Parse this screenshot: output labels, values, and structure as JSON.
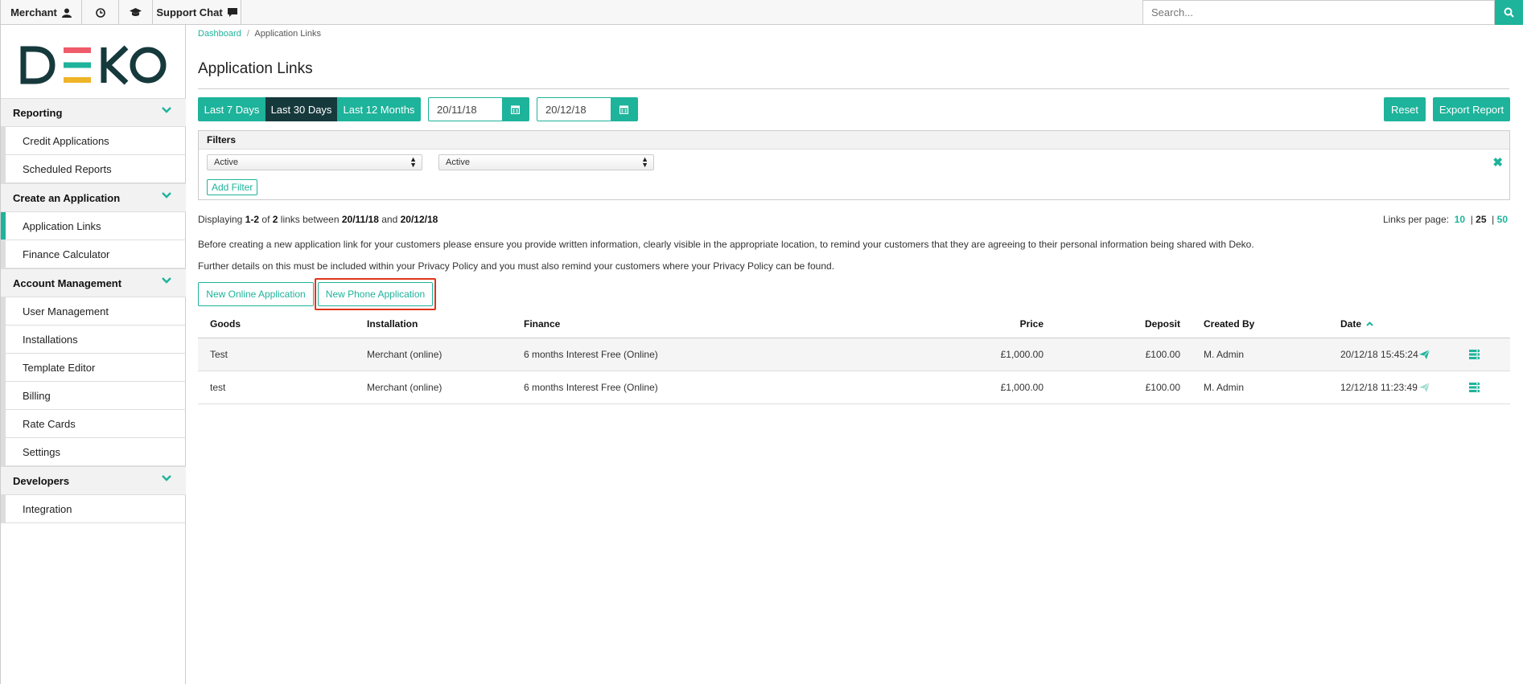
{
  "topbar": {
    "merchant_label": "Merchant",
    "support_label": "Support Chat",
    "search_placeholder": "Search..."
  },
  "sidebar": {
    "logo_text": "DEKO",
    "sections": [
      {
        "label": "Reporting",
        "items": [
          "Credit Applications",
          "Scheduled Reports"
        ]
      },
      {
        "label": "Create an Application",
        "items": [
          "Application Links",
          "Finance Calculator"
        ]
      },
      {
        "label": "Account Management",
        "items": [
          "User Management",
          "Installations",
          "Template Editor",
          "Billing",
          "Rate Cards",
          "Settings"
        ]
      },
      {
        "label": "Developers",
        "items": [
          "Integration"
        ]
      }
    ],
    "active_item": "Application Links"
  },
  "breadcrumb": {
    "root": "Dashboard",
    "separator": "/",
    "current": "Application Links"
  },
  "page": {
    "title": "Application Links"
  },
  "period": {
    "options": [
      "Last 7 Days",
      "Last 30 Days",
      "Last 12 Months"
    ],
    "selected": "Last 30 Days",
    "date_from": "20/11/18",
    "date_to": "20/12/18",
    "reset_label": "Reset",
    "export_label": "Export Report"
  },
  "filters": {
    "heading": "Filters",
    "filter_1": "Active",
    "filter_2": "Active",
    "remove_icon": "✖",
    "add_label": "Add Filter"
  },
  "summary": {
    "prefix": "Displaying",
    "range": "1-2",
    "of": "of",
    "total": "2",
    "mid": "links between",
    "from": "20/11/18",
    "and": "and",
    "to": "20/12/18"
  },
  "per_page": {
    "label": "Links per page:",
    "options": [
      "10",
      "25",
      "50"
    ],
    "selected": "25"
  },
  "notices": [
    "Before creating a new application link for your customers please ensure you provide written information, clearly visible in the appropriate location, to remind your customers that they are agreeing to their personal information being shared with Deko.",
    "Further details on this must be included within your Privacy Policy and you must also remind your customers where your Privacy Policy can be found."
  ],
  "buttons": {
    "new_online": "New Online Application",
    "new_phone": "New Phone Application"
  },
  "table": {
    "headers": [
      "Goods",
      "Installation",
      "Finance",
      "Price",
      "Deposit",
      "Created By",
      "Date"
    ],
    "rows": [
      {
        "goods": "Test",
        "installation": "Merchant (online)",
        "finance": "6 months Interest Free (Online)",
        "price": "£1,000.00",
        "deposit": "£100.00",
        "created_by": "M. Admin",
        "date": "20/12/18 15:45:24",
        "send_enabled": true
      },
      {
        "goods": "test",
        "installation": "Merchant (online)",
        "finance": "6 months Interest Free (Online)",
        "price": "£1,000.00",
        "deposit": "£100.00",
        "created_by": "M. Admin",
        "date": "12/12/18 11:23:49",
        "send_enabled": false
      }
    ]
  },
  "colors": {
    "accent": "#1eb39b",
    "dark": "#16393c",
    "highlight": "#e0341a"
  }
}
